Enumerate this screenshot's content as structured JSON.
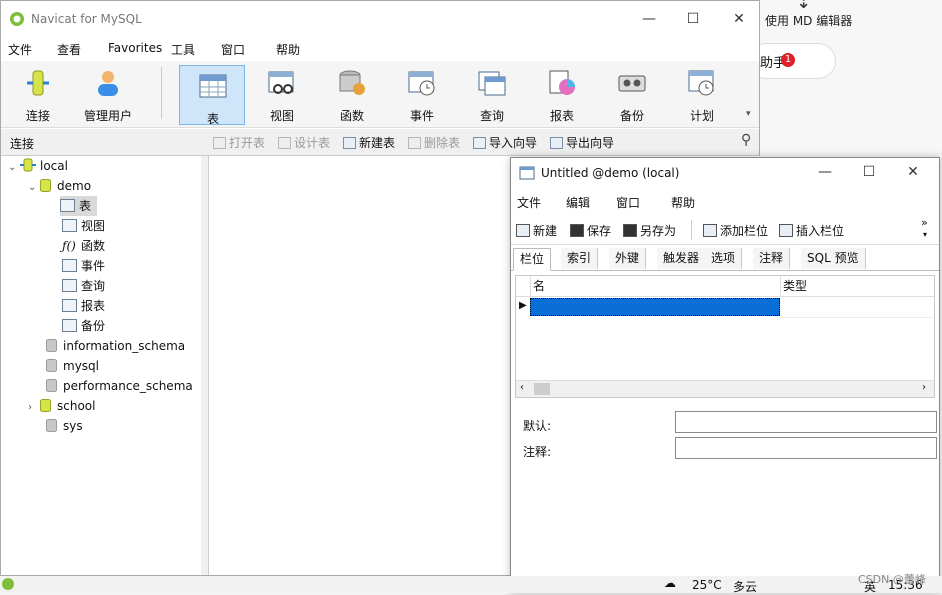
{
  "background": {
    "md_editor_label": "使用 MD 编辑器",
    "assistant_label": "助手",
    "assistant_badge": "1"
  },
  "main_window": {
    "title": "Navicat for MySQL",
    "menu": [
      "文件",
      "查看",
      "Favorites",
      "工具",
      "窗口",
      "帮助"
    ],
    "toolbar": [
      "连接",
      "管理用户",
      "表",
      "视图",
      "函数",
      "事件",
      "查询",
      "报表",
      "备份",
      "计划"
    ],
    "toolbar_selected": "表",
    "sidebar_title": "连接",
    "subtoolbar": [
      {
        "label": "打开表",
        "enabled": false
      },
      {
        "label": "设计表",
        "enabled": false
      },
      {
        "label": "新建表",
        "enabled": true
      },
      {
        "label": "删除表",
        "enabled": false
      },
      {
        "label": "导入向导",
        "enabled": true
      },
      {
        "label": "导出向导",
        "enabled": true
      }
    ],
    "tree": {
      "connection": "local",
      "open_db": "demo",
      "objects": [
        "表",
        "视图",
        "函数",
        "事件",
        "查询",
        "报表",
        "备份"
      ],
      "other_dbs": [
        "information_schema",
        "mysql",
        "performance_schema",
        "school",
        "sys"
      ]
    }
  },
  "table_window": {
    "title": "Untitled @demo (local)",
    "menu": [
      "文件",
      "编辑",
      "窗口",
      "帮助"
    ],
    "toolbar": [
      "新建",
      "保存",
      "另存为",
      "添加栏位",
      "插入栏位"
    ],
    "tabs": [
      "栏位",
      "索引",
      "外键",
      "触发器",
      "选项",
      "注释",
      "SQL 预览"
    ],
    "selected_tab": "栏位",
    "columns": [
      "名",
      "类型"
    ],
    "default_label": "默认:",
    "comment_label": "注释:"
  },
  "taskbar": {
    "temperature": "25°C",
    "weather": "多云",
    "lang": "英",
    "time": "15:36"
  },
  "watermark": "CSDN @蕾峰"
}
